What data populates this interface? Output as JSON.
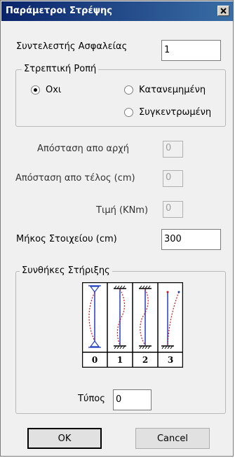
{
  "window": {
    "title": "Παράμετροι Στρέψης",
    "close_glyph": "×"
  },
  "safety_factor": {
    "label": "Συντελεστής Ασφαλείας",
    "value": "1"
  },
  "torsion_moment": {
    "legend": "Στρεπτική Ροπή",
    "options": [
      {
        "label": "Oxι",
        "selected": true
      },
      {
        "label": "Κατανεμημένη",
        "selected": false
      },
      {
        "label": "Συγκεντρωμένη",
        "selected": false
      }
    ]
  },
  "distance_start": {
    "label": "Απόσταση απο αρχή",
    "value": "0"
  },
  "distance_end": {
    "label": "Απόσταση απο τέλος (cm)",
    "value": "0"
  },
  "value_knm": {
    "label": "Τιμή (KNm)",
    "value": "0"
  },
  "element_length": {
    "label": "Μήκος Στοιχείου  (cm)",
    "value": "300"
  },
  "support_conditions": {
    "legend": "Συνθήκες Στήριξης",
    "types": [
      "0",
      "1",
      "2",
      "3"
    ],
    "type_label": "Τύπος",
    "type_value": "0"
  },
  "buttons": {
    "ok": "OK",
    "cancel": "Cancel"
  },
  "colors": {
    "title_start": "#0a246a",
    "title_end": "#3a6ea5",
    "beam": "#1f3fc0",
    "deflection": "#e01010"
  }
}
